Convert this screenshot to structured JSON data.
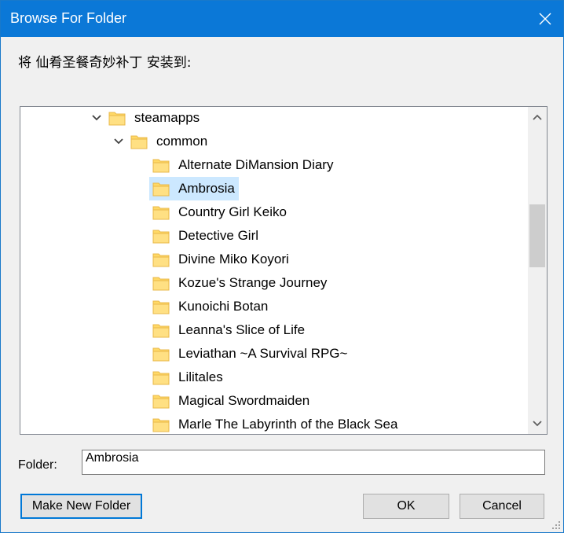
{
  "window": {
    "title": "Browse For Folder"
  },
  "instruction": "将 仙肴圣餐奇妙补丁 安装到:",
  "tree": {
    "items": [
      {
        "label": "steamapps",
        "level": 0,
        "expanded": true,
        "selected": false
      },
      {
        "label": "common",
        "level": 1,
        "expanded": true,
        "selected": false
      },
      {
        "label": "Alternate DiMansion Diary",
        "level": 2,
        "selected": false
      },
      {
        "label": "Ambrosia",
        "level": 2,
        "selected": true
      },
      {
        "label": "Country Girl Keiko",
        "level": 2,
        "selected": false
      },
      {
        "label": "Detective Girl",
        "level": 2,
        "selected": false
      },
      {
        "label": "Divine Miko Koyori",
        "level": 2,
        "selected": false
      },
      {
        "label": "Kozue's Strange Journey",
        "level": 2,
        "selected": false
      },
      {
        "label": "Kunoichi Botan",
        "level": 2,
        "selected": false
      },
      {
        "label": "Leanna's Slice of Life",
        "level": 2,
        "selected": false
      },
      {
        "label": "Leviathan ~A Survival RPG~",
        "level": 2,
        "selected": false
      },
      {
        "label": "Lilitales",
        "level": 2,
        "selected": false
      },
      {
        "label": "Magical Swordmaiden",
        "level": 2,
        "selected": false
      },
      {
        "label": "Marle The Labyrinth of the Black Sea",
        "level": 2,
        "selected": false
      }
    ]
  },
  "folder_field": {
    "label": "Folder:",
    "value": "Ambrosia"
  },
  "buttons": {
    "make_new_folder": "Make New Folder",
    "ok": "OK",
    "cancel": "Cancel"
  },
  "colors": {
    "titlebar": "#0b78d7",
    "selection": "#cce8ff",
    "folder_fill": "#ffd966",
    "focus_border": "#0078d7"
  },
  "icons": {
    "close": "close-icon",
    "expand": "chevron-down-icon",
    "folder": "folder-icon",
    "scroll_up": "chevron-up-icon",
    "scroll_down": "chevron-down-icon"
  }
}
